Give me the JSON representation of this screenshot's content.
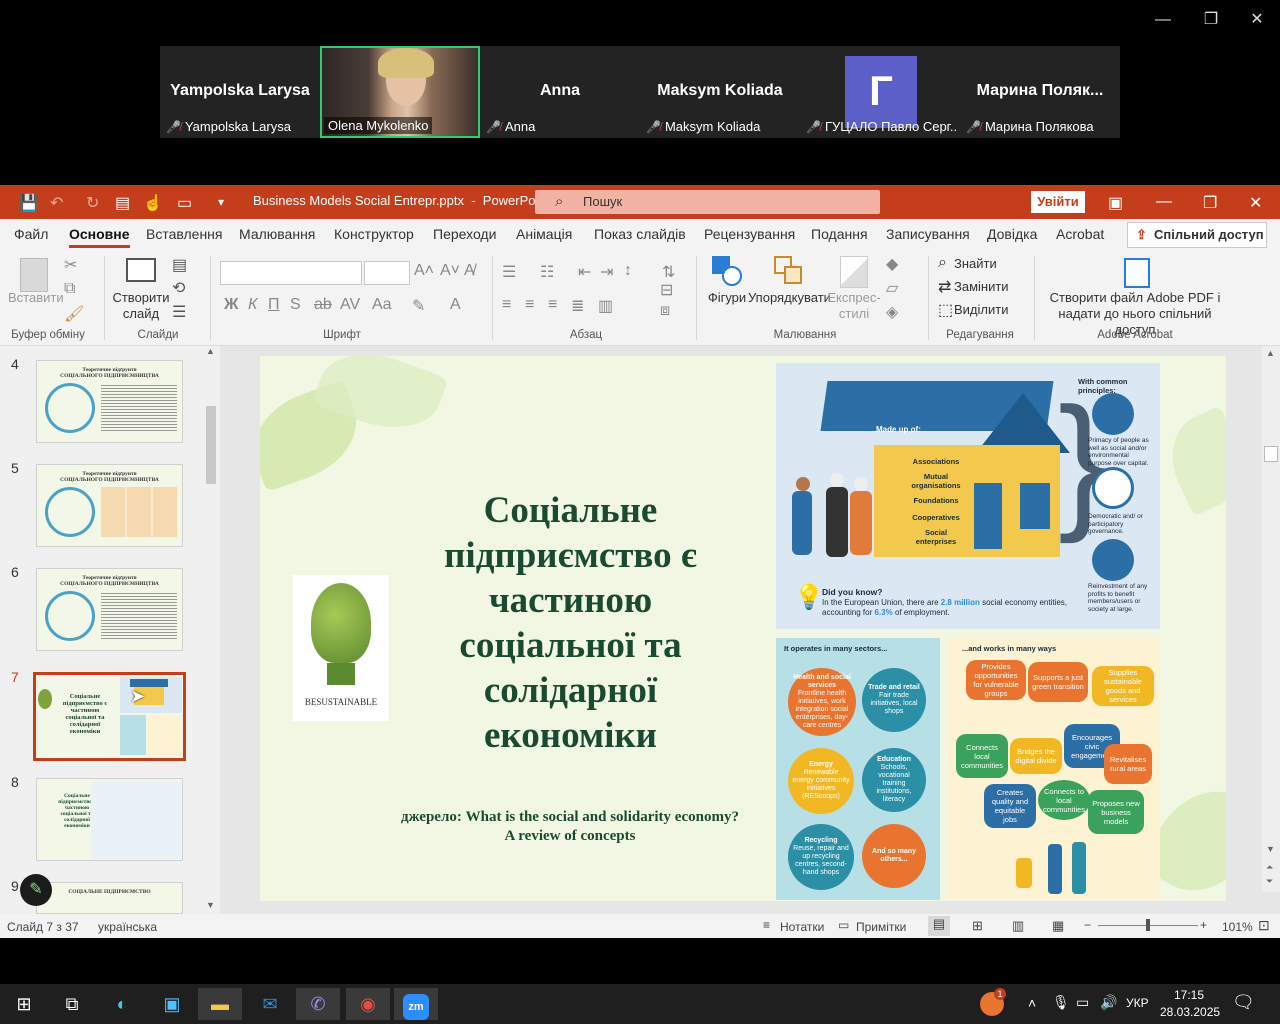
{
  "zoom": {
    "window_controls": {
      "minimize": "—",
      "maximize": "❐",
      "close": "✕"
    },
    "participants": [
      {
        "display": "Yampolska Larysa",
        "name": "Yampolska Larysa",
        "muted": true,
        "video": false
      },
      {
        "display": "",
        "name": "Olena Mykolenko",
        "muted": false,
        "video": true
      },
      {
        "display": "Anna",
        "name": "Anna",
        "muted": true,
        "video": false
      },
      {
        "display": "Maksym Koliada",
        "name": "Maksym Koliada",
        "muted": true,
        "video": false
      },
      {
        "display": "Г",
        "name": "ГУЦАЛО Павло Серг...",
        "muted": true,
        "video": false,
        "avatar": true
      },
      {
        "display": "Марина  Поляк...",
        "name": "Марина Полякова",
        "muted": true,
        "video": false
      }
    ]
  },
  "ppt": {
    "window_title": "Business Models Social Entrepr.pptx  -  PowerPoint",
    "search_placeholder": "Пошук",
    "signin": "Увійти",
    "menu": [
      "Файл",
      "Основне",
      "Вставлення",
      "Малювання",
      "Конструктор",
      "Переходи",
      "Анімація",
      "Показ слайдів",
      "Рецензування",
      "Подання",
      "Записування",
      "Довідка",
      "Acrobat"
    ],
    "active_menu": "Основне",
    "share": "Спільний доступ",
    "ribbon": {
      "paste": "Вставити",
      "new_slide": "Створити\nслайд",
      "shapes": "Фігури",
      "arrange": "Упорядкувати",
      "quick_styles": "Експрес-\nстилі",
      "find": "Знайти",
      "replace": "Замінити",
      "select": "Виділити",
      "acrobat_pdf": "Створити файл Adobe PDF і\nнадати до нього спільний доступ",
      "groups": [
        "Буфер обміну",
        "Слайди",
        "Шрифт",
        "Абзац",
        "Малювання",
        "Редагування",
        "Adobe Acrobat"
      ]
    },
    "thumbnails": [
      {
        "num": "4",
        "title": "Теоретичне підґрунтя\nСОЦІАЛЬНОГО ПІДПРИЄМНИЦТВА"
      },
      {
        "num": "5",
        "title": "Теоретичне підґрунтя\nСОЦІАЛЬНОГО ПІДПРИЄМНИЦТВА"
      },
      {
        "num": "6",
        "title": "Теоретичне підґрунтя\nСОЦІАЛЬНОГО ПІДПРИЄМНИЦТВА"
      },
      {
        "num": "7",
        "title": "Соціальне\nпідприємство є\nчастиною\nсоціальної та\nсолідарної\nекономіки",
        "selected": true
      },
      {
        "num": "8",
        "title": "Соціальне\nпідприємство є\nчастиною\nсоціальної та\nсолідарної\nекономіки"
      },
      {
        "num": "9",
        "title": "СОЦІАЛЬНЕ ПІДПРИЄМСТВО"
      }
    ],
    "slide": {
      "title": "Соціальне\nпідприємство є\nчастиною\nсоціальної та\nсолідарної\nекономіки",
      "source": "джерело: What is the social and solidarity economy?\nA review of concepts",
      "logo_text": "BESUSTAINABLE",
      "info": {
        "made_up_of": "Made up of:",
        "entities": [
          "Associations",
          "Mutual\norganisations",
          "Foundations",
          "Cooperatives",
          "Social\nenterprises"
        ],
        "principles_title": "With common principles:",
        "principles": [
          "Primacy of people as well as social and/or environmental purpose over capital.",
          "Democratic and/ or participatory governance.",
          "Reinvestment of any profits to benefit members/users or society at large."
        ],
        "did_you_know": "Did you know?",
        "fact_pre": "In the European Union, there are ",
        "fact_num1": "2.8 million",
        "fact_mid": " social economy entities, accounting for ",
        "fact_num2": "6.3%",
        "fact_post": " of employment.",
        "sectors_title": "It operates in many sectors...",
        "sectors": [
          {
            "t": "Health and social services",
            "d": "Frontline health initiatives, work integration social enterprises, day-care centres",
            "color": "#e8742f"
          },
          {
            "t": "Trade and retail",
            "d": "Fair trade initiatives, local shops",
            "color": "#2b8fa6"
          },
          {
            "t": "Energy",
            "d": "Renewable energy community initiatives (REScoops)",
            "color": "#f2b823"
          },
          {
            "t": "Education",
            "d": "Schools, vocational training institutions, literacy",
            "color": "#2b8fa6"
          },
          {
            "t": "Recycling",
            "d": "Reuse, repair and up recycling centres, second-hand shops",
            "color": "#2b8fa6"
          },
          {
            "t": "And so many others...",
            "d": "",
            "color": "#e8742f"
          }
        ],
        "ways_title": "...and works in many ways",
        "ways": [
          {
            "t": "Provides opportunities for vulnerable groups",
            "color": "#e8742f"
          },
          {
            "t": "Supports a just green transition",
            "color": "#e8742f"
          },
          {
            "t": "Supplies sustainable goods and services",
            "color": "#f2b823"
          },
          {
            "t": "Connects local communities",
            "color": "#3aa25c"
          },
          {
            "t": "Bridges the digital divide",
            "color": "#f2b823"
          },
          {
            "t": "Encourages civic engagement",
            "color": "#2b6fa6"
          },
          {
            "t": "Revitalises rural areas",
            "color": "#e8742f"
          },
          {
            "t": "Creates quality and equitable jobs",
            "color": "#2b6fa6"
          },
          {
            "t": "Connects to local communities",
            "color": "#3aa25c"
          },
          {
            "t": "Proposes new business models",
            "color": "#3aa25c"
          }
        ]
      }
    },
    "status": {
      "slide_count": "Слайд 7 з 37",
      "language": "українська",
      "notes": "Нотатки",
      "comments": "Примітки",
      "zoom": "101%"
    }
  },
  "taskbar": {
    "lang": "УКР",
    "time": "17:15",
    "date": "28.03.2025",
    "notif_count": "1"
  },
  "colors": {
    "ppt_accent": "#c43e1c",
    "slide_title": "#1a4a31",
    "slide_bg": "#f2f7e3",
    "zoom_active": "#2ecc71"
  }
}
